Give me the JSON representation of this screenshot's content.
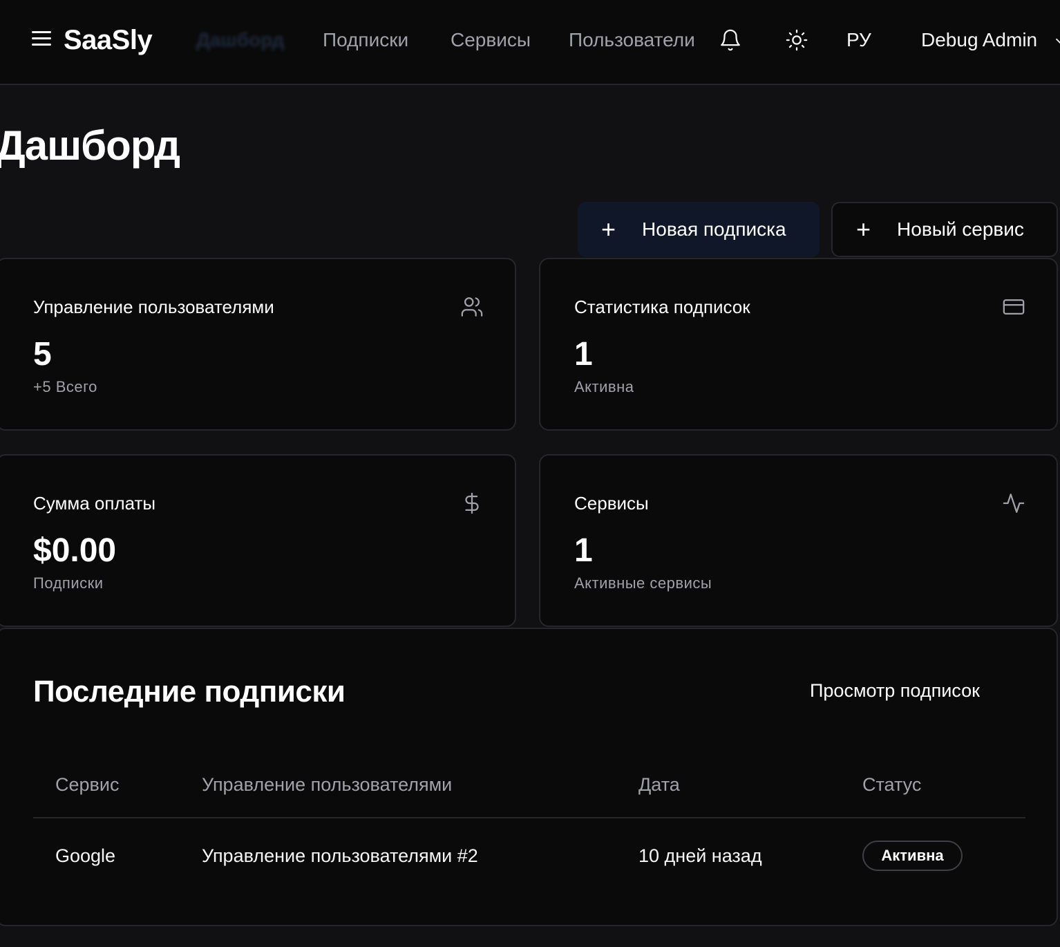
{
  "header": {
    "logo": "SaaSly",
    "nav": [
      "Дашборд",
      "Подписки",
      "Сервисы",
      "Пользователи"
    ],
    "language": "РУ",
    "user": "Debug Admin"
  },
  "page": {
    "title": "Дашборд"
  },
  "actions": {
    "new_subscription": "Новая подписка",
    "new_service": "Новый сервис"
  },
  "stats": [
    {
      "title": "Управление пользователями",
      "value": "5",
      "sub": "+5 Всего",
      "icon": "users-icon"
    },
    {
      "title": "Статистика подписок",
      "value": "1",
      "sub": "Активна",
      "icon": "credit-card-icon"
    },
    {
      "title": "Сумма оплаты",
      "value": "$0.00",
      "sub": "Подписки",
      "icon": "dollar-icon"
    },
    {
      "title": "Сервисы",
      "value": "1",
      "sub": "Активные сервисы",
      "icon": "activity-icon"
    }
  ],
  "recent": {
    "title": "Последние подписки",
    "view_link": "Просмотр подписок",
    "columns": [
      "Сервис",
      "Управление пользователями",
      "Дата",
      "Статус"
    ],
    "rows": [
      {
        "service": "Google",
        "user": "Управление пользователями #2",
        "date": "10 дней назад",
        "status": "Активна"
      }
    ]
  },
  "colors": {
    "background": "#111113",
    "card": "#0a0a0b",
    "border": "#27272a",
    "muted": "#a1a1aa",
    "primary_button": "#0f1729"
  }
}
